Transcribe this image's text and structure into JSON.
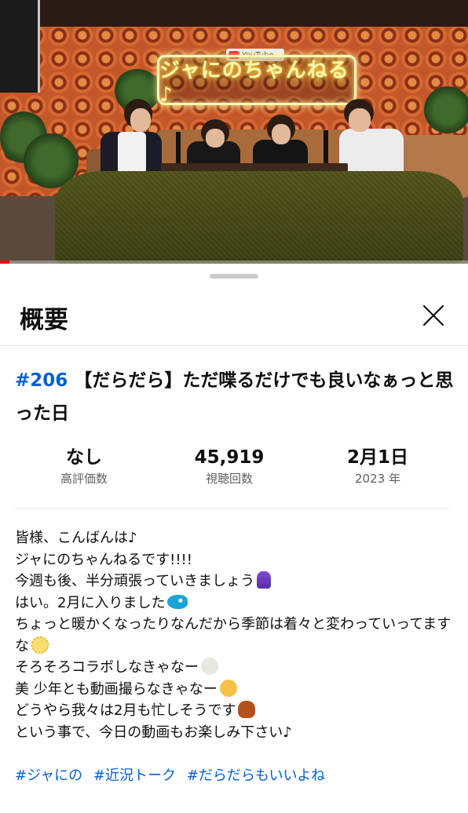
{
  "video": {
    "neon_sign_text": "ジャにのちゃんねる♪",
    "youtube_badge": "YouTube",
    "progress_fraction": 0.02
  },
  "sheet": {
    "title": "概要",
    "close_icon": "close-icon"
  },
  "video_info": {
    "episode_tag": "#206",
    "title_text": "【だらだら】ただ喋るだけでも良いなぁっと思った日"
  },
  "stats": {
    "likes_value": "なし",
    "likes_label": "高評価数",
    "views_value": "45,919",
    "views_label": "視聴回数",
    "date_value": "2月1日",
    "date_label": "2023 年"
  },
  "description": {
    "lines": [
      "皆様、こんばんは♪",
      "ジャにのちゃんねるです!!!!",
      "今週も後、半分頑張っていきましょう",
      "はい。2月に入りました",
      "ちょっと暖かくなったりなんだから季節は着々と変わっていってますな",
      "そろそろコラボしなきゃなー",
      "美 少年とも動画撮らなきゃなー",
      "どうやら我々は2月も忙しそうです",
      "という事で、今日の動画もお楽しみ下さい♪"
    ],
    "emoji_names": [
      "dancer-emoji",
      "tropical-fish-emoji",
      "neutral-face-emoji",
      "cold-face-emoji",
      "peeking-face-emoji",
      "orangutan-emoji"
    ]
  },
  "hashtags": [
    "#ジャにの",
    "#近況トーク",
    "#だらだらもいいよね"
  ],
  "colors": {
    "link_blue": "#065fd4",
    "progress_red": "#ff0000",
    "secondary_text": "#606060"
  }
}
